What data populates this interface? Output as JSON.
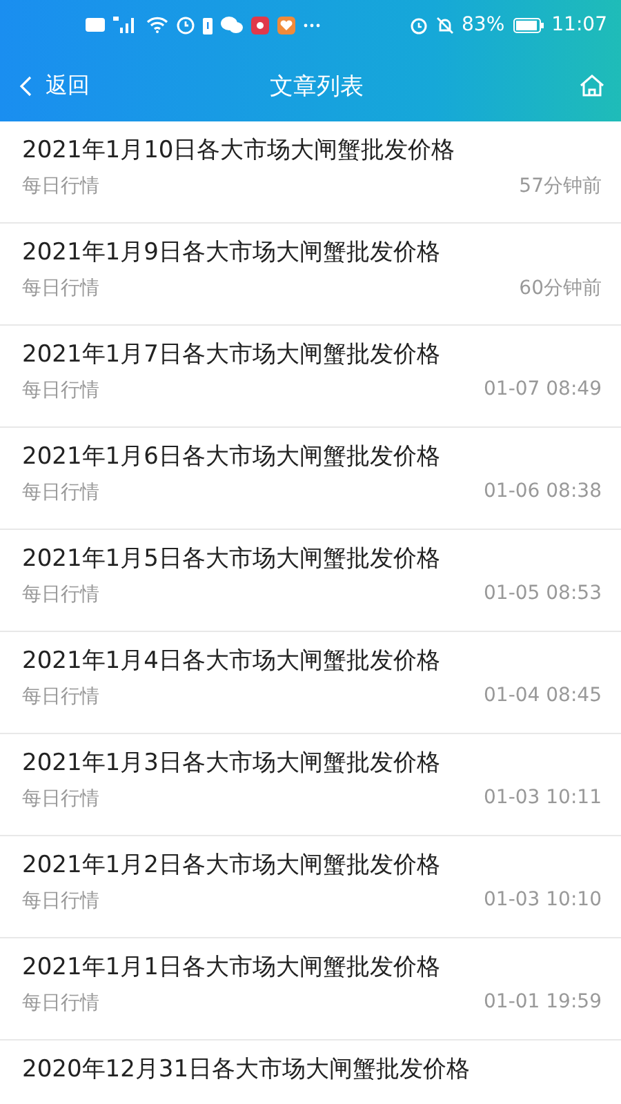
{
  "status_bar": {
    "battery": "83%",
    "time": "11:07"
  },
  "nav": {
    "back": "返回",
    "title": "文章列表"
  },
  "articles": [
    {
      "title": "2021年1月10日各大市场大闸蟹批发价格",
      "category": "每日行情",
      "time": "57分钟前"
    },
    {
      "title": "2021年1月9日各大市场大闸蟹批发价格",
      "category": "每日行情",
      "time": "60分钟前"
    },
    {
      "title": "2021年1月7日各大市场大闸蟹批发价格",
      "category": "每日行情",
      "time": "01-07 08:49"
    },
    {
      "title": "2021年1月6日各大市场大闸蟹批发价格",
      "category": "每日行情",
      "time": "01-06 08:38"
    },
    {
      "title": "2021年1月5日各大市场大闸蟹批发价格",
      "category": "每日行情",
      "time": "01-05 08:53"
    },
    {
      "title": "2021年1月4日各大市场大闸蟹批发价格",
      "category": "每日行情",
      "time": "01-04 08:45"
    },
    {
      "title": "2021年1月3日各大市场大闸蟹批发价格",
      "category": "每日行情",
      "time": "01-03 10:11"
    },
    {
      "title": "2021年1月2日各大市场大闸蟹批发价格",
      "category": "每日行情",
      "time": "01-03 10:10"
    },
    {
      "title": "2021年1月1日各大市场大闸蟹批发价格",
      "category": "每日行情",
      "time": "01-01 19:59"
    },
    {
      "title": "2020年12月31日各大市场大闸蟹批发价格"
    }
  ]
}
